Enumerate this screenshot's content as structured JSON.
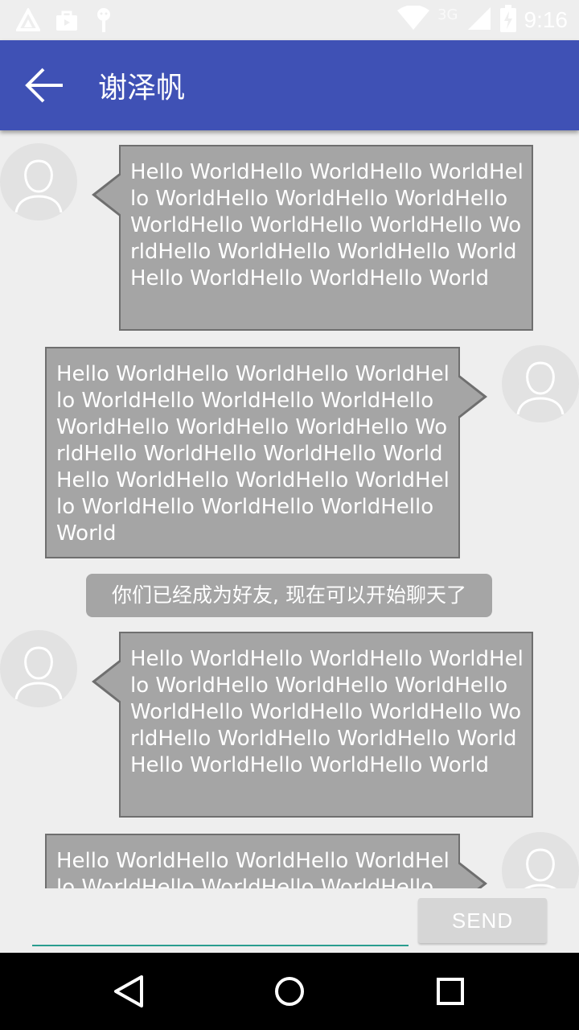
{
  "status_bar": {
    "time": "9:16",
    "network": "3G",
    "icons": [
      "android-app-icon",
      "store-bag-icon",
      "debug-bug-icon",
      "wifi-icon",
      "signal-icon",
      "battery-charging-icon"
    ]
  },
  "app_bar": {
    "title": "谢泽帆",
    "back_icon": "arrow-left-icon",
    "color": "#3f51b5"
  },
  "messages": [
    {
      "side": "left",
      "text": "Hello WorldHello WorldHello WorldHello WorldHello WorldHello WorldHello WorldHello WorldHello WorldHello WorldHello WorldHello WorldHello WorldHello WorldHello WorldHello World"
    },
    {
      "side": "right",
      "text": "Hello WorldHello WorldHello WorldHello WorldHello WorldHello WorldHello WorldHello WorldHello WorldHello WorldHello WorldHello WorldHello WorldHello WorldHello WorldHello WorldHello WorldHello WorldHello WorldHello World"
    },
    {
      "side": "system",
      "text": "你们已经成为好友, 现在可以开始聊天了"
    },
    {
      "side": "left",
      "text": "Hello WorldHello WorldHello WorldHello WorldHello WorldHello WorldHello WorldHello WorldHello WorldHello WorldHello WorldHello WorldHello WorldHello WorldHello WorldHello World"
    },
    {
      "side": "right",
      "text": "Hello WorldHello WorldHello WorldHello WorldHello WorldHello WorldHello"
    }
  ],
  "input": {
    "value": "",
    "placeholder": ""
  },
  "send_label": "SEND",
  "nav_bar": {
    "icons": [
      "back-triangle-icon",
      "home-circle-icon",
      "recents-square-icon"
    ]
  }
}
